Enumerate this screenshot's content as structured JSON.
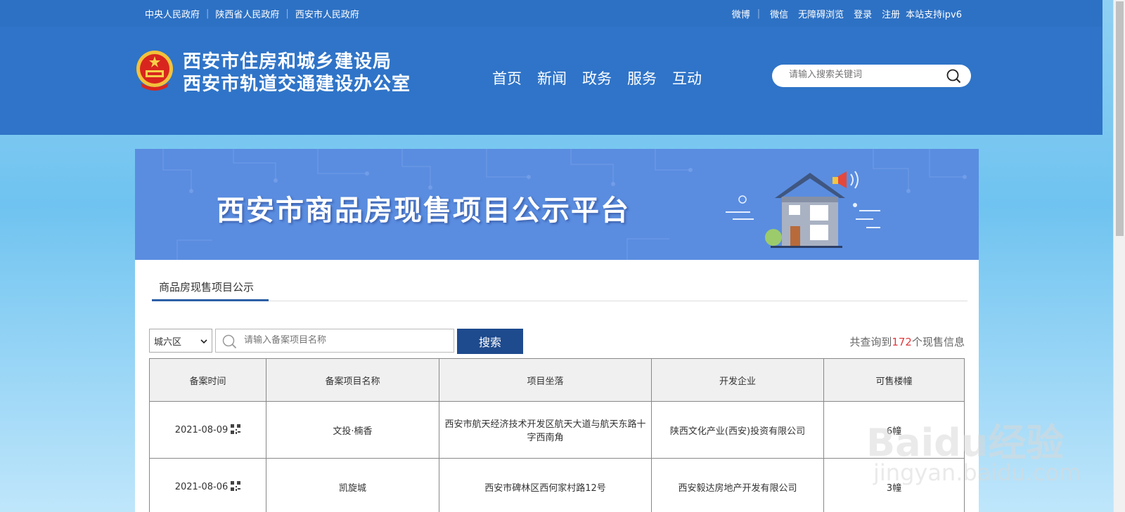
{
  "topbar": {
    "left_links": [
      "中央人民政府",
      "陕西省人民政府",
      "西安市人民政府"
    ],
    "right_links": [
      "微博",
      "微信",
      "无障碍浏览",
      "登录",
      "注册",
      "本站支持ipv6"
    ]
  },
  "header": {
    "org_line1": "西安市住房和城乡建设局",
    "org_line2": "西安市轨道交通建设办公室",
    "nav": [
      "首页",
      "新闻",
      "政务",
      "服务",
      "互动"
    ],
    "search_placeholder": "请输入搜索关键词"
  },
  "banner": {
    "title": "西安市商品房现售项目公示平台"
  },
  "content": {
    "tab_label": "商品房现售项目公示",
    "district_select": "城六区",
    "project_placeholder": "请输入备案项目名称",
    "search_button": "搜索",
    "result_prefix": "共查询到",
    "result_count": "172",
    "result_suffix": "个现售信息"
  },
  "table": {
    "headers": [
      "备案时间",
      "备案项目名称",
      "项目坐落",
      "开发企业",
      "可售楼幢"
    ],
    "rows": [
      {
        "date": "2021-08-09",
        "name": "文投·楠香",
        "location": "西安市航天经济技术开发区航天大道与航天东路十字西南角",
        "developer": "陕西文化产业(西安)投资有限公司",
        "buildings": "6幢"
      },
      {
        "date": "2021-08-06",
        "name": "凯旋城",
        "location": "西安市碑林区西何家村路12号",
        "developer": "西安毅达房地产开发有限公司",
        "buildings": "3幢"
      }
    ]
  },
  "watermark": {
    "text": "Baidu经验",
    "sub": "jingyan.baidu.com"
  },
  "colors": {
    "topbar": "#2d71c4",
    "header": "#2f74c8",
    "banner": "#5a8de0",
    "button": "#1e4a8e",
    "count": "#e0393e"
  },
  "icons": {
    "search": "search-icon",
    "emblem": "national-emblem-icon",
    "qr": "qr-code-icon",
    "select_arrow": "chevron-down-icon"
  }
}
